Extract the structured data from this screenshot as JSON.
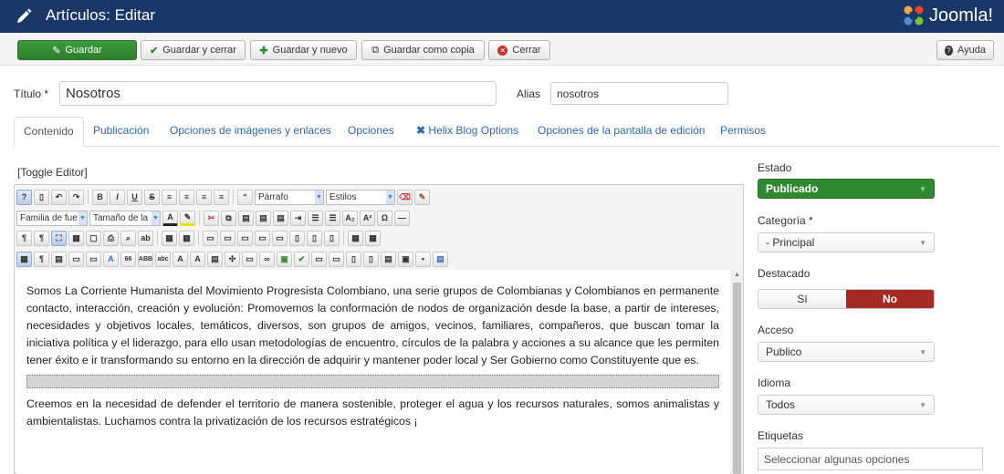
{
  "header": {
    "title": "Artículos: Editar",
    "logo": "Joomla!",
    "bg": "#1a3867"
  },
  "toolbar": {
    "save": "Guardar",
    "save_close": "Guardar y cerrar",
    "save_new": "Guardar y nuevo",
    "save_copy": "Guardar como copia",
    "close": "Cerrar",
    "help": "Ayuda"
  },
  "form": {
    "title_label": "Título *",
    "title_value": "Nosotros",
    "alias_label": "Alias",
    "alias_value": "nosotros"
  },
  "tabs": [
    "Contenido",
    "Publicación",
    "Opciones de imágenes y enlaces",
    "Opciones",
    "Helix Blog Options",
    "Opciones de la pantalla de edición",
    "Permisos"
  ],
  "editor": {
    "toggle": "[Toggle Editor]",
    "format_select": "Párrafo",
    "styles_select": "Estilos",
    "font_family_select": "Familia de fue",
    "font_size_select": "Tamaño de la",
    "paragraph1": "Somos La Corriente Humanista del Movimiento Progresista Colombiano, una serie grupos de Colombianas y Colombianos en permanente contacto, interacción, creación y evolución: Promovemos la conformación de nodos de organización desde la base, a partir de intereses, necesidades y objetivos locales, temáticos, diversos, son grupos de amigos, vecinos, familiares, compañeros, que buscan tomar la iniciativa política y el liderazgo, para ello usan metodologías de encuentro, círculos de la palabra y acciones a su alcance que les permiten tener éxito e ir transformando su entorno en la dirección de adquirir y mantener poder local y Ser Gobierno como Constituyente que es.",
    "paragraph2": "Creemos en la necesidad de defender el territorio de manera sostenible, proteger el agua y los recursos naturales, somos animalistas y ambientalistas. Luchamos contra la privatización de los recursos estratégicos ¡"
  },
  "sidebar": {
    "status_label": "Estado",
    "status_value": "Publicado",
    "status_color": "#2f8a2f",
    "category_label": "Categoría *",
    "category_value": "- Principal",
    "featured_label": "Destacado",
    "featured_yes": "Sí",
    "featured_no": "No",
    "featured_no_color": "#a52a23",
    "access_label": "Acceso",
    "access_value": "Publico",
    "language_label": "Idioma",
    "language_value": "Todos",
    "tags_label": "Etiquetas",
    "tags_placeholder": "Seleccionar algunas opciones"
  }
}
